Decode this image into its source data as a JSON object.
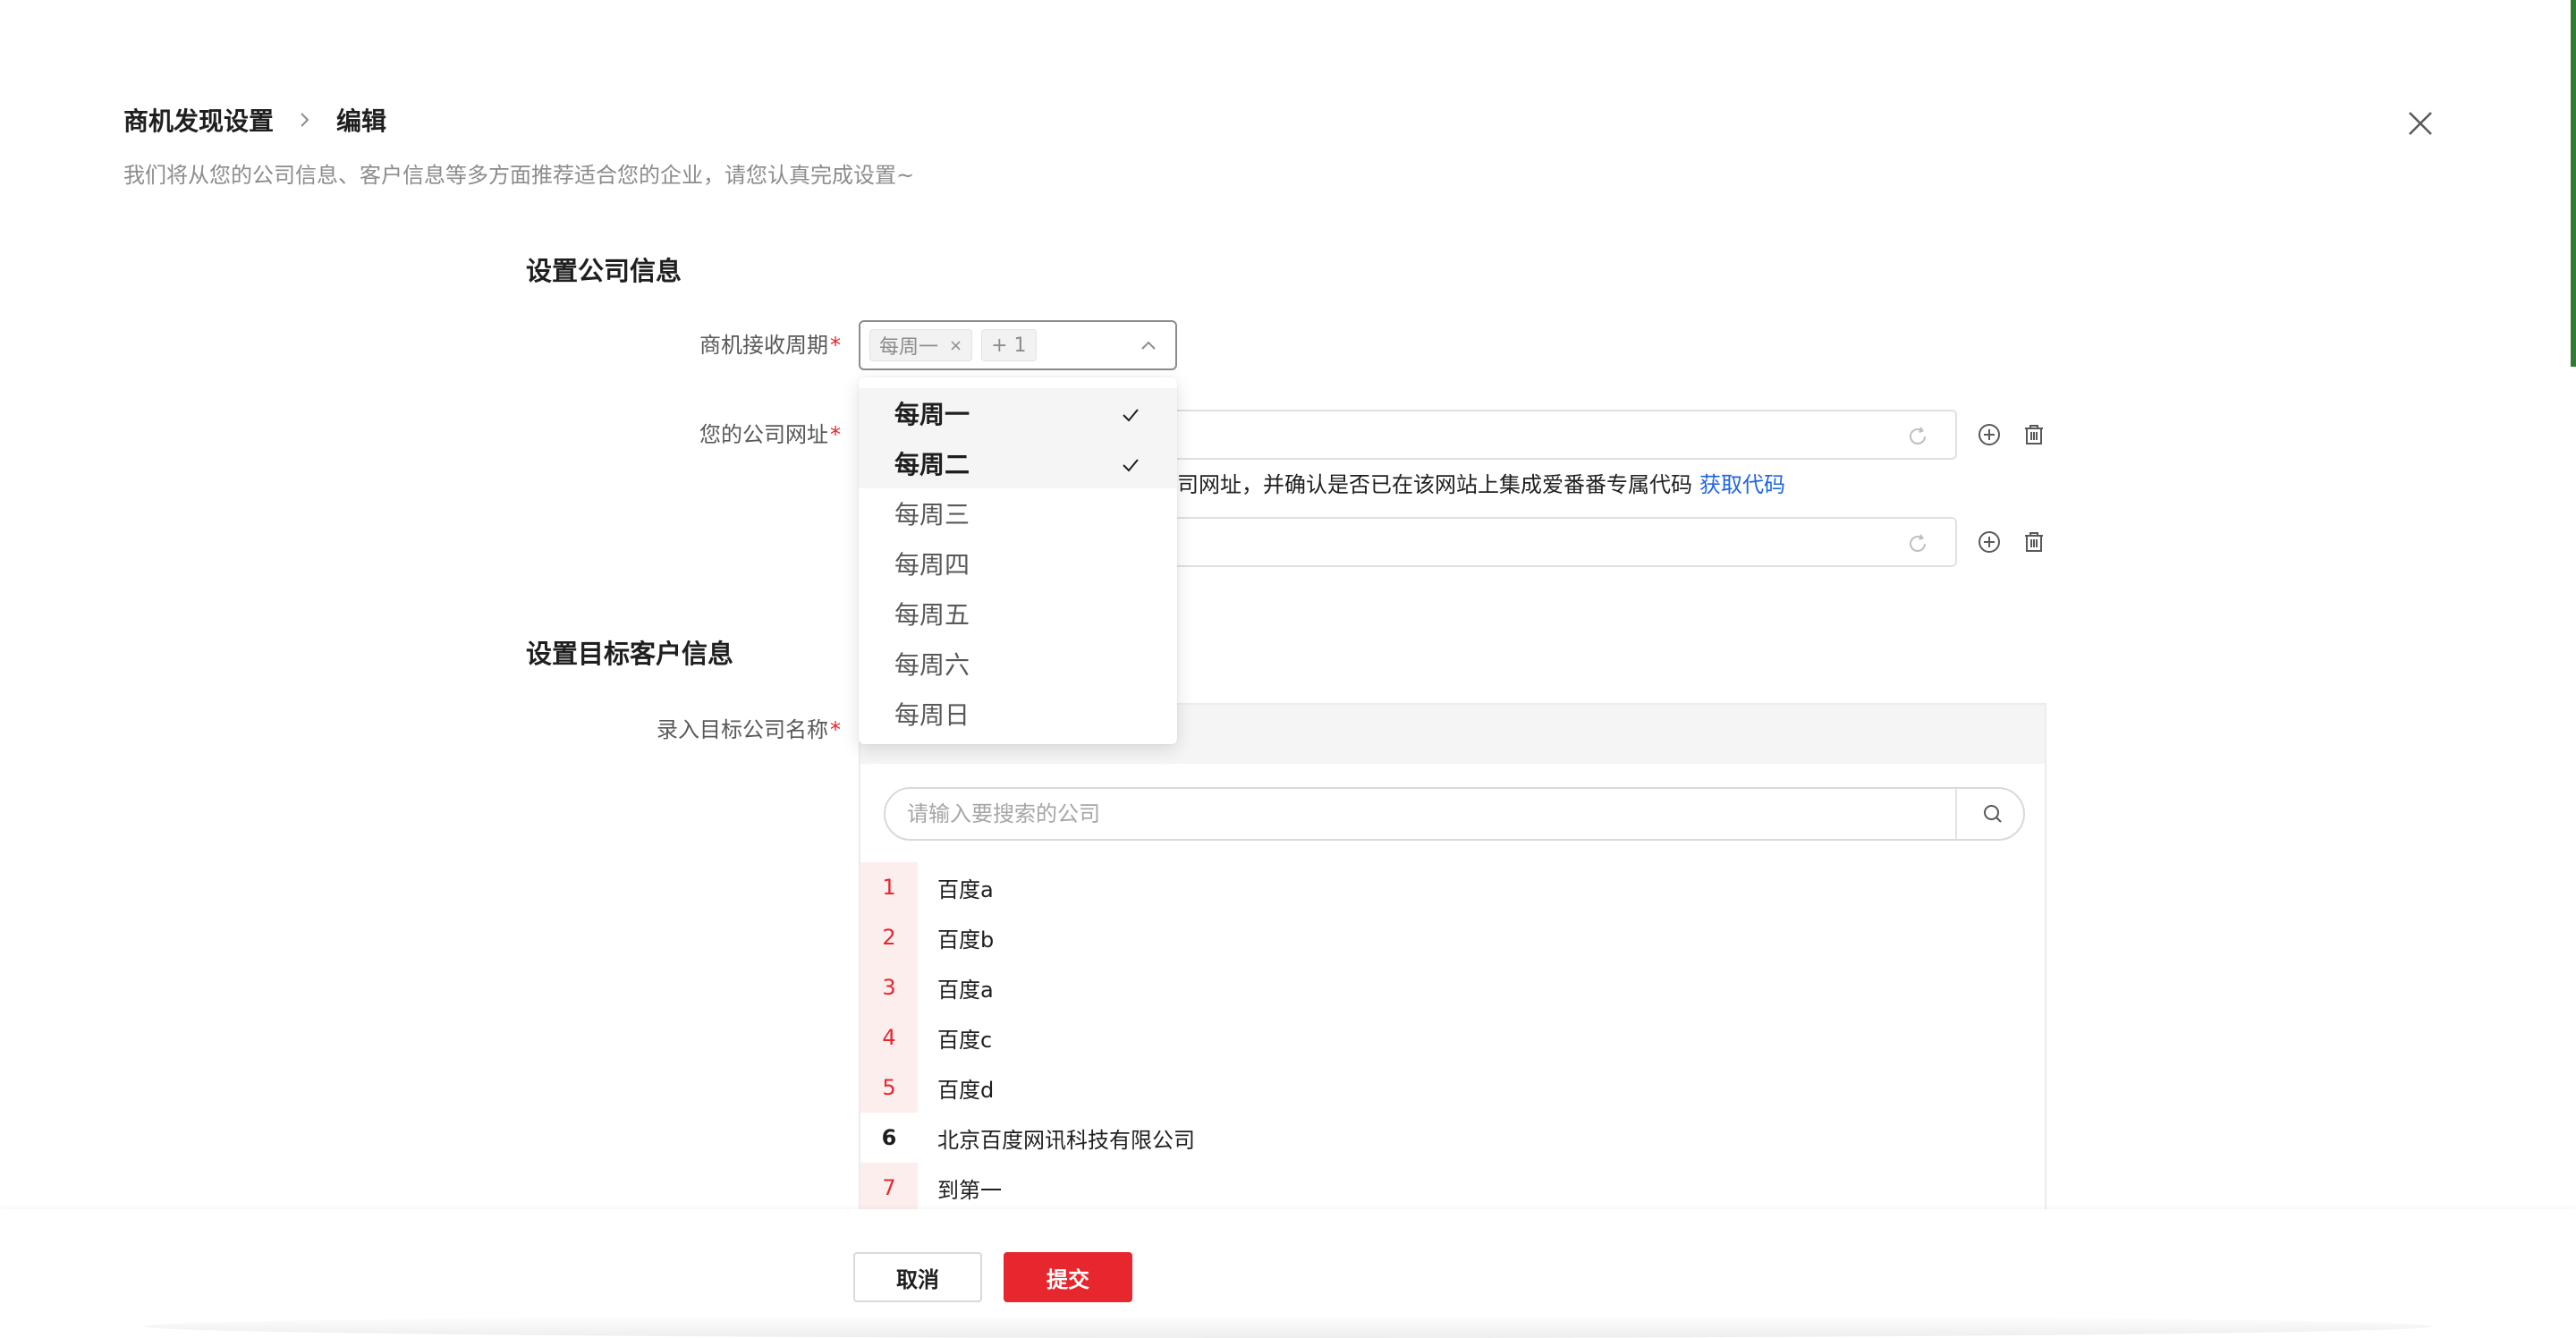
{
  "header": {
    "breadcrumb_root": "商机发现设置",
    "breadcrumb_current": "编辑",
    "subtitle": "我们将从您的公司信息、客户信息等多方面推荐适合您的企业，请您认真完成设置~"
  },
  "company_section": {
    "title": "设置公司信息",
    "cycle_label": "商机接收周期",
    "url_label": "您的公司网址",
    "required_mark": "*",
    "selected_tag": "每周一",
    "tag_remove": "×",
    "more_tag": "+ 1",
    "hint_text": "司网址，并确认是否已在该网站上集成爱番番专属代码",
    "hint_link": "获取代码"
  },
  "dropdown": {
    "options": [
      {
        "label": "每周一",
        "selected": true
      },
      {
        "label": "每周二",
        "selected": true
      },
      {
        "label": "每周三",
        "selected": false
      },
      {
        "label": "每周四",
        "selected": false
      },
      {
        "label": "每周五",
        "selected": false
      },
      {
        "label": "每周六",
        "selected": false
      },
      {
        "label": "每周日",
        "selected": false
      }
    ]
  },
  "target_section": {
    "title": "设置目标客户信息",
    "name_label": "录入目标公司名称",
    "search_placeholder": "请输入要搜索的公司",
    "rows": [
      {
        "num": "1",
        "name": "百度a"
      },
      {
        "num": "2",
        "name": "百度b"
      },
      {
        "num": "3",
        "name": "百度a"
      },
      {
        "num": "4",
        "name": "百度c"
      },
      {
        "num": "5",
        "name": "百度d"
      },
      {
        "num": "6",
        "name": "北京百度网讯科技有限公司"
      },
      {
        "num": "7",
        "name": "到第一"
      }
    ]
  },
  "footer": {
    "cancel_label": "取消",
    "submit_label": "提交"
  },
  "colors": {
    "accent_red": "#e8262d",
    "link_blue": "#1f66e0",
    "edge_green": "#2e7d32"
  }
}
